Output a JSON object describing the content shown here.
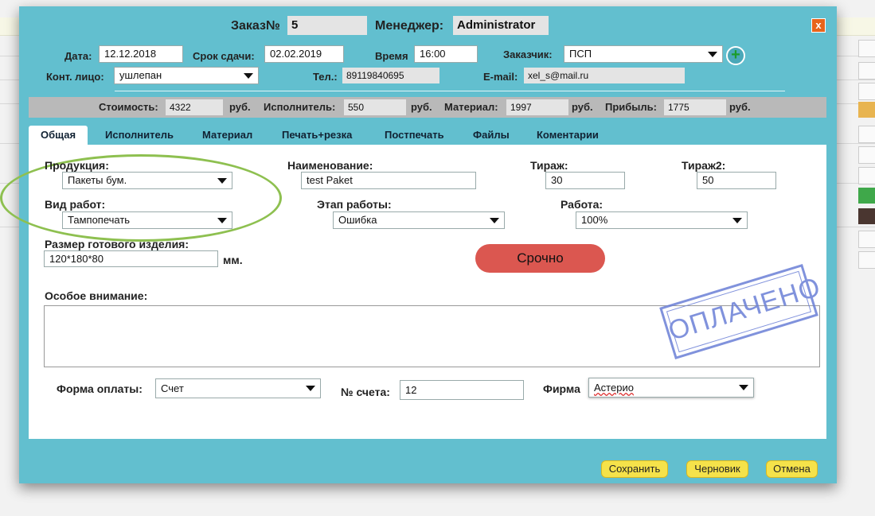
{
  "header": {
    "order_label": "Заказ№",
    "order_number": "5",
    "manager_label": "Менеджер:",
    "manager_value": "Administrator",
    "close_glyph": "x"
  },
  "info": {
    "date_label": "Дата:",
    "date_value": "12.12.2018",
    "due_label": "Срок сдачи:",
    "due_value": "02.02.2019",
    "time_label": "Время",
    "time_value": "16:00",
    "customer_label": "Заказчик:",
    "customer_value": "ПСП",
    "add_glyph": "+",
    "contact_label": "Конт. лицо:",
    "contact_value": "ушлепан",
    "phone_label": "Тел.:",
    "phone_value": "89119840695",
    "email_label": "E-mail:",
    "email_value": "xel_s@mail.ru"
  },
  "costs": {
    "cost_label": "Стоимость:",
    "cost_value": "4322",
    "rub1": "руб.",
    "executor_label": "Исполнитель:",
    "executor_value": "550",
    "rub2": "руб.",
    "material_label": "Материал:",
    "material_value": "1997",
    "rub3": "руб.",
    "profit_label": "Прибыль:",
    "profit_value": "1775",
    "rub4": "руб."
  },
  "tabs": [
    "Общая",
    "Исполнитель",
    "Материал",
    "Печать+резка",
    "Постпечать",
    "Файлы",
    "Коментарии"
  ],
  "form": {
    "product_label": "Продукция:",
    "product_value": "Пакеты бум.",
    "name_label": "Наименование:",
    "name_value": "test Paket",
    "run_label": "Тираж:",
    "run_value": "30",
    "run2_label": "Тираж2:",
    "run2_value": "50",
    "worktype_label": "Вид работ:",
    "worktype_value": "Тампопечать",
    "stage_label": "Этап работы:",
    "stage_value": "Ошибка",
    "work_label": "Работа:",
    "work_value": "100%",
    "size_label": "Размер готового изделия:",
    "size_value": "120*180*80",
    "size_unit": "мм.",
    "urgent_label": "Срочно",
    "attention_label": "Особое внимание:",
    "attention_value": "",
    "stamp_text": "ОПЛАЧЕНО",
    "payment_label": "Форма оплаты:",
    "payment_value": "Счет",
    "invoice_label": "№ счета:",
    "invoice_value": "12",
    "firm_label": "Фирма",
    "firm_value": "Астерио"
  },
  "buttons": {
    "save": "Сохранить",
    "draft": "Черновик",
    "cancel": "Отмена"
  },
  "colors": {
    "modal_bg": "#62bfcf",
    "urgent": "#db5750",
    "stamp": "#6b7fd6",
    "button": "#f5e24a",
    "close": "#e8641b",
    "highlight": "#8ec050"
  }
}
